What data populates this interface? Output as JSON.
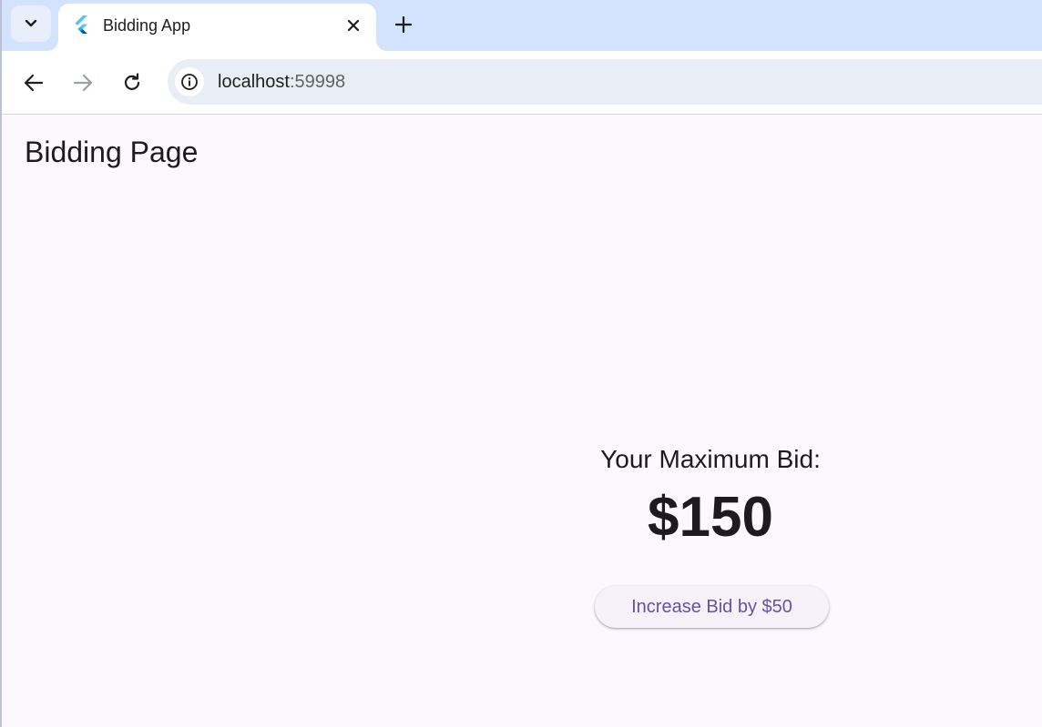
{
  "browser": {
    "tab_title": "Bidding App",
    "url_host": "localhost",
    "url_port": ":59998",
    "icons": {
      "tab_search": "chevron-down-icon",
      "favicon": "flutter-logo-icon",
      "close": "close-icon",
      "new_tab": "plus-icon",
      "back": "arrow-left-icon",
      "forward": "arrow-right-icon",
      "reload": "reload-icon",
      "site_info": "info-icon"
    }
  },
  "app": {
    "page_title": "Bidding Page",
    "bid_label": "Your Maximum Bid:",
    "bid_amount": "$150",
    "increase_button_label": "Increase Bid by $50",
    "colors": {
      "background": "#fdf7fe",
      "button_text": "#6750a4",
      "button_background": "#f7f2fa",
      "text": "#1d1b20"
    }
  }
}
